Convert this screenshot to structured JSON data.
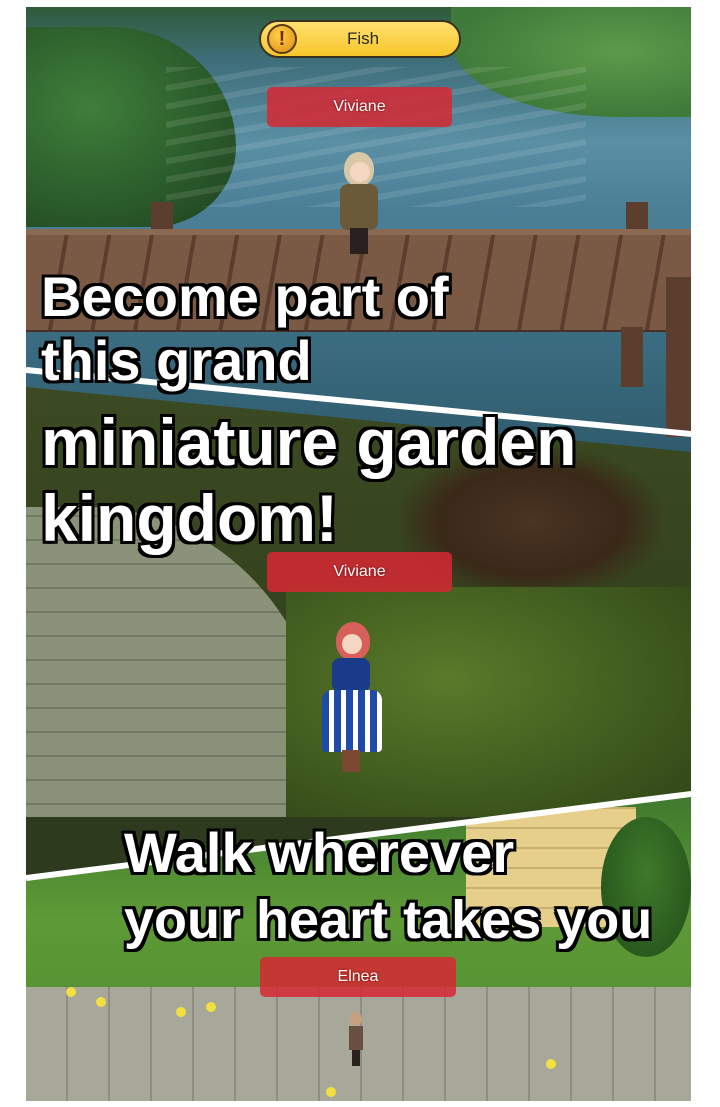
{
  "quest": {
    "icon": "exclamation-icon",
    "icon_glyph": "!",
    "label": "Fish"
  },
  "nameplates": {
    "top": "Viviane",
    "middle": "Viviane",
    "bottom": "Elnea"
  },
  "headlines": {
    "first": [
      "Become part of",
      "this grand",
      "miniature garden",
      "kingdom!"
    ],
    "second": [
      "Walk wherever",
      "your heart takes you"
    ]
  },
  "colors": {
    "nameplate": "#d62832",
    "quest_pill": "#f7c62a",
    "headline_text": "#ffffff",
    "headline_outline": "#000000"
  }
}
